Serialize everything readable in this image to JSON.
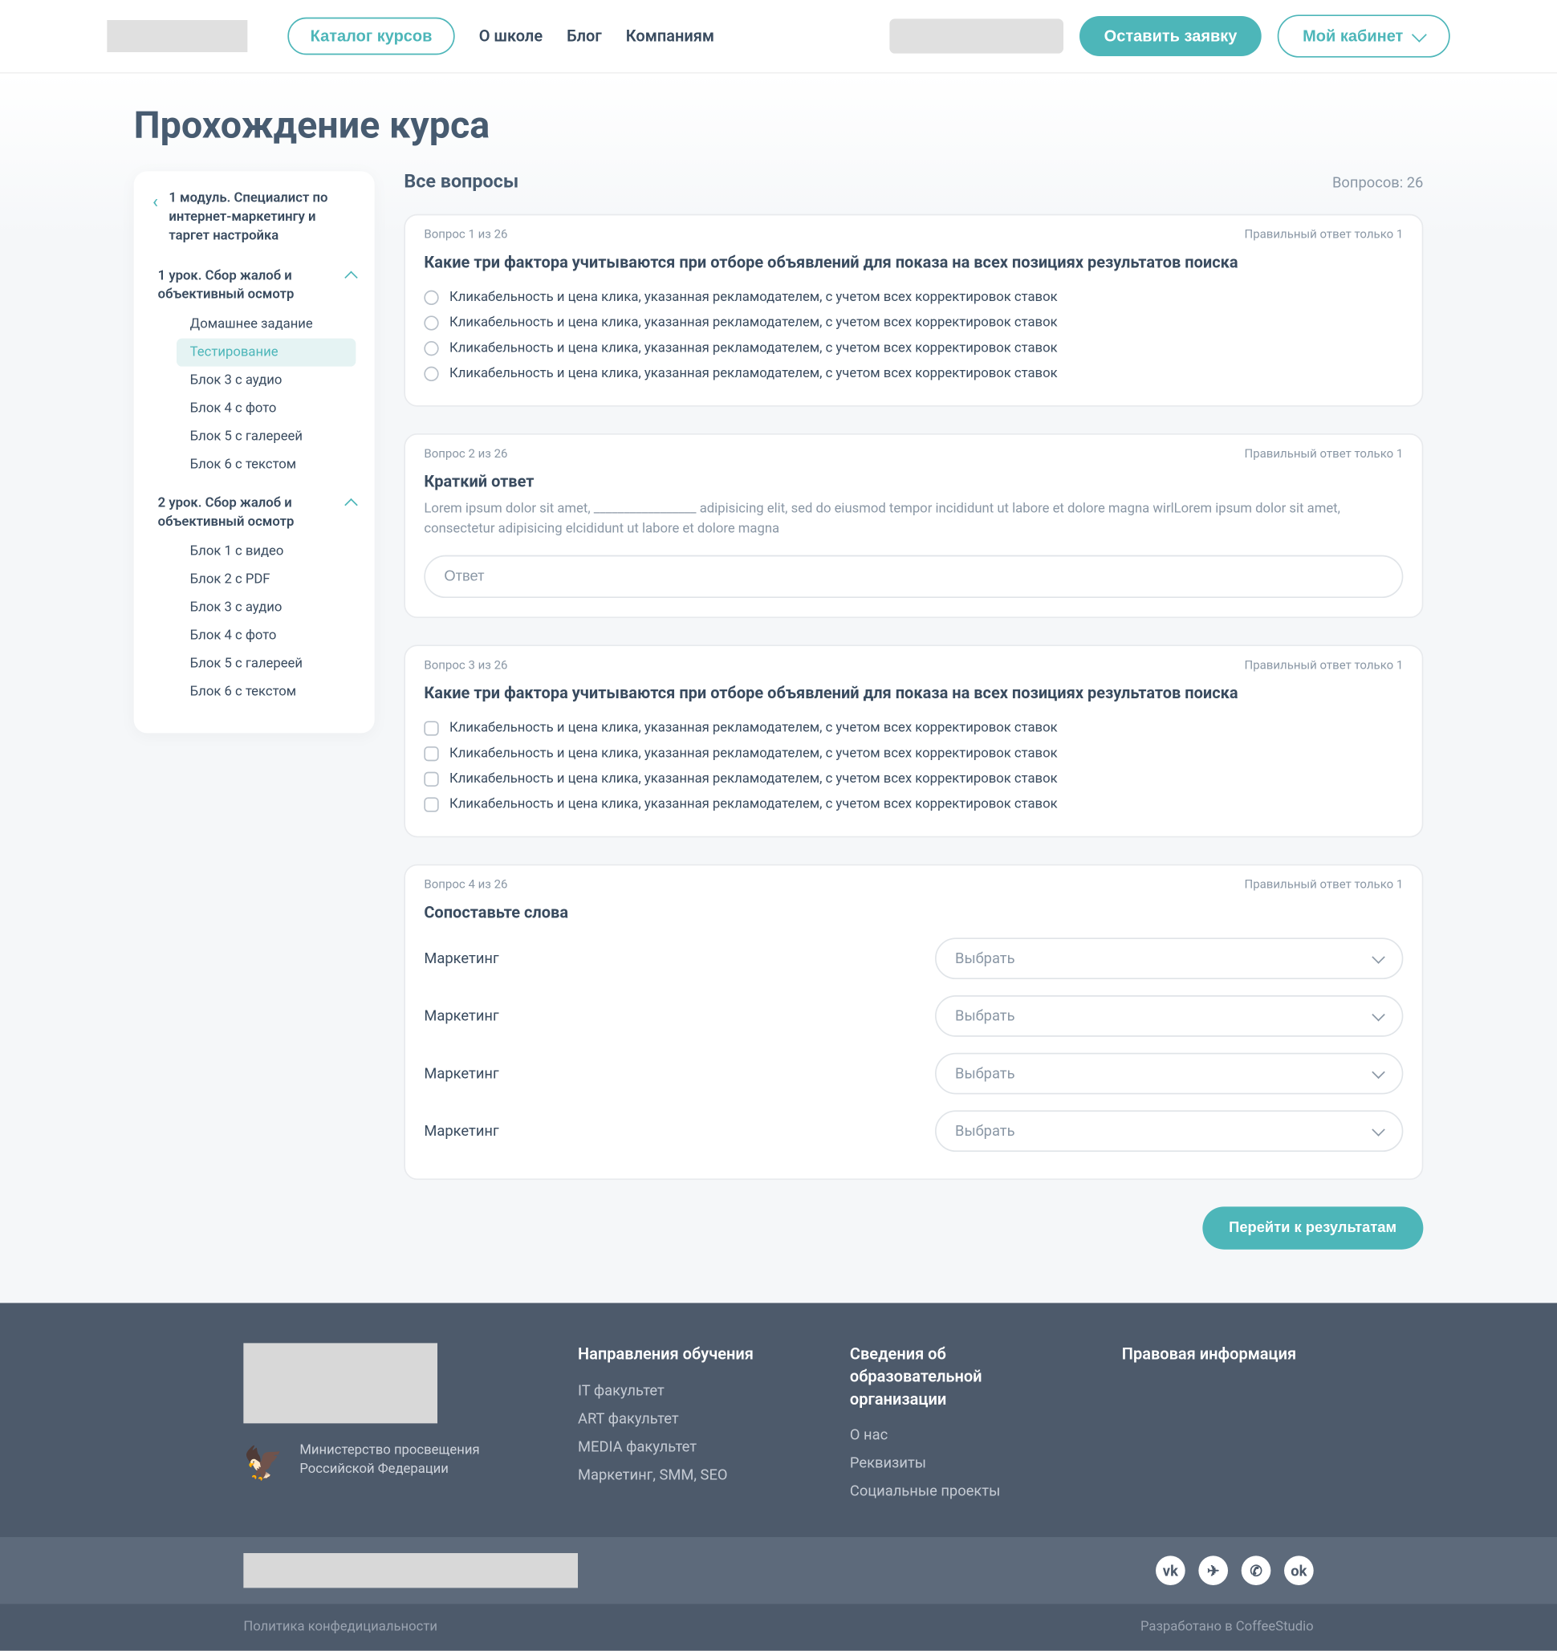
{
  "header": {
    "catalog": "Каталог курсов",
    "nav": [
      "О школе",
      "Блог",
      "Компаниям"
    ],
    "request_btn": "Оставить заявку",
    "cabinet": "Мой кабинет"
  },
  "page_title": "Прохождение курса",
  "sidebar": {
    "module": "1 модуль. Специалист по интернет-маркетингу и таргет настройка",
    "lessons": [
      {
        "title": "1 урок. Сбор жалоб и объективный осмотр",
        "items": [
          "Домашнее задание",
          "Тестирование",
          "Блок 3 с аудио",
          "Блок 4 с фото",
          "Блок 5 с галереей",
          "Блок 6 с текстом"
        ],
        "active_index": 1
      },
      {
        "title": "2 урок. Сбор жалоб и объективный осмотр",
        "items": [
          "Блок 1 с видео",
          "Блок 2 с PDF",
          "Блок 3 с аудио",
          "Блок 4 с фото",
          "Блок 5 с галереей",
          "Блок 6 с текстом"
        ]
      }
    ]
  },
  "content": {
    "title": "Все вопросы",
    "count_label": "Вопросов: 26",
    "questions": [
      {
        "meta_left": "Вопрос 1 из 26",
        "meta_right": "Правильный ответ только 1",
        "text": "Какие три фактора учитываются при отборе объявлений для показа на всех позициях результатов поиска",
        "options": [
          "Кликабельность и цена клика, указанная рекламодателем, с учетом всех корректировок ставок",
          "Кликабельность и цена клика, указанная рекламодателем, с учетом всех корректировок ставок",
          "Кликабельность и цена клика, указанная рекламодателем, с учетом всех корректировок ставок",
          "Кликабельность и цена клика, указанная рекламодателем, с учетом всех корректировок ставок"
        ]
      },
      {
        "meta_left": "Вопрос 2 из 26",
        "meta_right": "Правильный ответ только 1",
        "title": "Краткий ответ",
        "desc": "Lorem ipsum dolor sit amet, _________________ adipisicing elit, sed do eiusmod tempor incididunt ut labore et dolore magna wirlLorem ipsum dolor sit amet, consectetur adipisicing elcididunt ut labore et dolore  magna",
        "placeholder": "Ответ"
      },
      {
        "meta_left": "Вопрос 3 из 26",
        "meta_right": "Правильный ответ только 1",
        "text": "Какие три фактора учитываются при отборе объявлений для показа на всех позициях результатов поиска",
        "options": [
          "Кликабельность и цена клика, указанная рекламодателем, с учетом всех корректировок ставок",
          "Кликабельность и цена клика, указанная рекламодателем, с учетом всех корректировок ставок",
          "Кликабельность и цена клика, указанная рекламодателем, с учетом всех корректировок ставок",
          "Кликабельность и цена клика, указанная рекламодателем, с учетом всех корректировок ставок"
        ]
      },
      {
        "meta_left": "Вопрос 4 из 26",
        "meta_right": "Правильный ответ только 1",
        "title": "Сопоставьте слова",
        "matches": [
          {
            "label": "Маркетинг",
            "select": "Выбрать"
          },
          {
            "label": "Маркетинг",
            "select": "Выбрать"
          },
          {
            "label": "Маркетинг",
            "select": "Выбрать"
          },
          {
            "label": "Маркетинг",
            "select": "Выбрать"
          }
        ]
      }
    ],
    "results_btn": "Перейти к результатам"
  },
  "footer": {
    "ministry": "Министерство просвещения Российской Федерации",
    "col2_title": "Направления обучения",
    "col2_links": [
      "IT факультет",
      "ART факультет",
      "MEDIA факультет",
      "Маркетинг, SMM, SEO"
    ],
    "col3_title": "Сведения об образовательной организации",
    "col3_links": [
      "О нас",
      "Реквизиты",
      "Социальные проекты"
    ],
    "col4_title": "Правовая информация",
    "privacy": "Политика конфедициальности",
    "dev": "Разработано в CoffeeStudio"
  }
}
